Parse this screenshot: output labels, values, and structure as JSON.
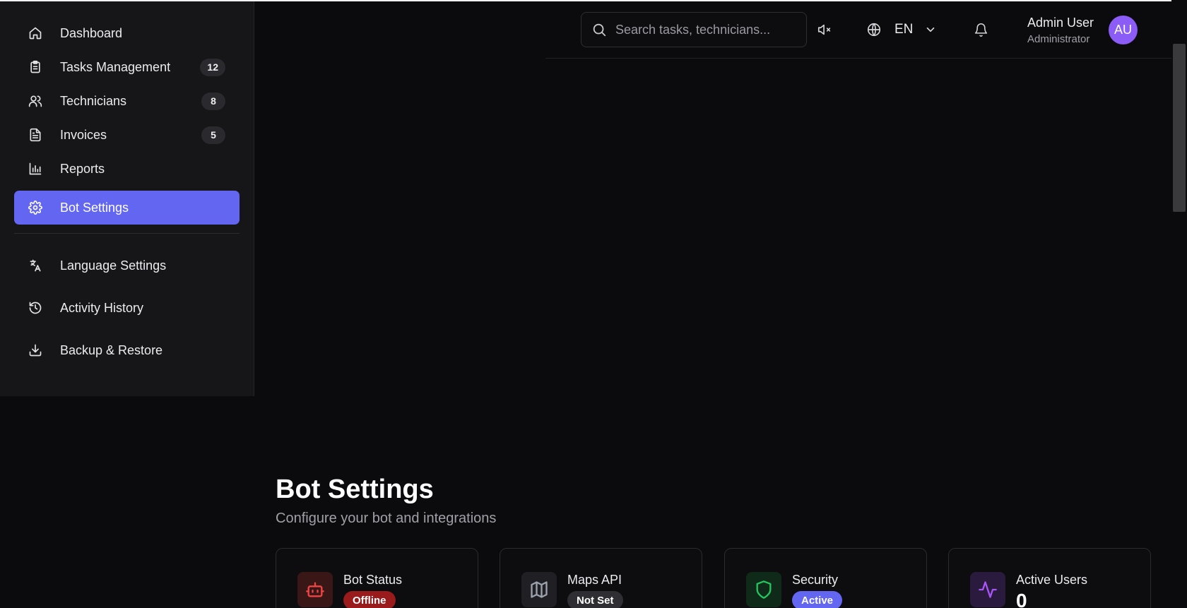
{
  "sidebar": {
    "items": [
      {
        "label": "Dashboard"
      },
      {
        "label": "Tasks Management",
        "badge": "12"
      },
      {
        "label": "Technicians",
        "badge": "8"
      },
      {
        "label": "Invoices",
        "badge": "5"
      },
      {
        "label": "Reports"
      },
      {
        "label": "Bot Settings",
        "active": true
      },
      {
        "label": "Language Settings"
      },
      {
        "label": "Activity History"
      },
      {
        "label": "Backup & Restore"
      }
    ]
  },
  "header": {
    "search_placeholder": "Search tasks, technicians...",
    "language": "EN",
    "user_name": "Admin User",
    "user_role": "Administrator",
    "avatar_initials": "AU"
  },
  "main": {
    "title": "Bot Settings",
    "subtitle": "Configure your bot and integrations",
    "cards": [
      {
        "title": "Bot Status",
        "badge": "Offline",
        "badge_color": "#991b1b",
        "icon": "bot-icon",
        "icon_color": "#ef4444"
      },
      {
        "title": "Maps API",
        "badge": "Not Set",
        "badge_color": "#2f2f33",
        "icon": "map-icon",
        "icon_color": "#9ca3af"
      },
      {
        "title": "Security",
        "badge": "Active",
        "badge_color": "#6366f1",
        "icon": "shield-icon",
        "icon_color": "#22c55e"
      },
      {
        "title": "Active Users",
        "value": "0",
        "icon": "activity-icon",
        "icon_color": "#a855f7"
      }
    ]
  },
  "colors": {
    "accent": "#6366f1",
    "background": "#0b0b0d",
    "sidebar": "#161618"
  }
}
